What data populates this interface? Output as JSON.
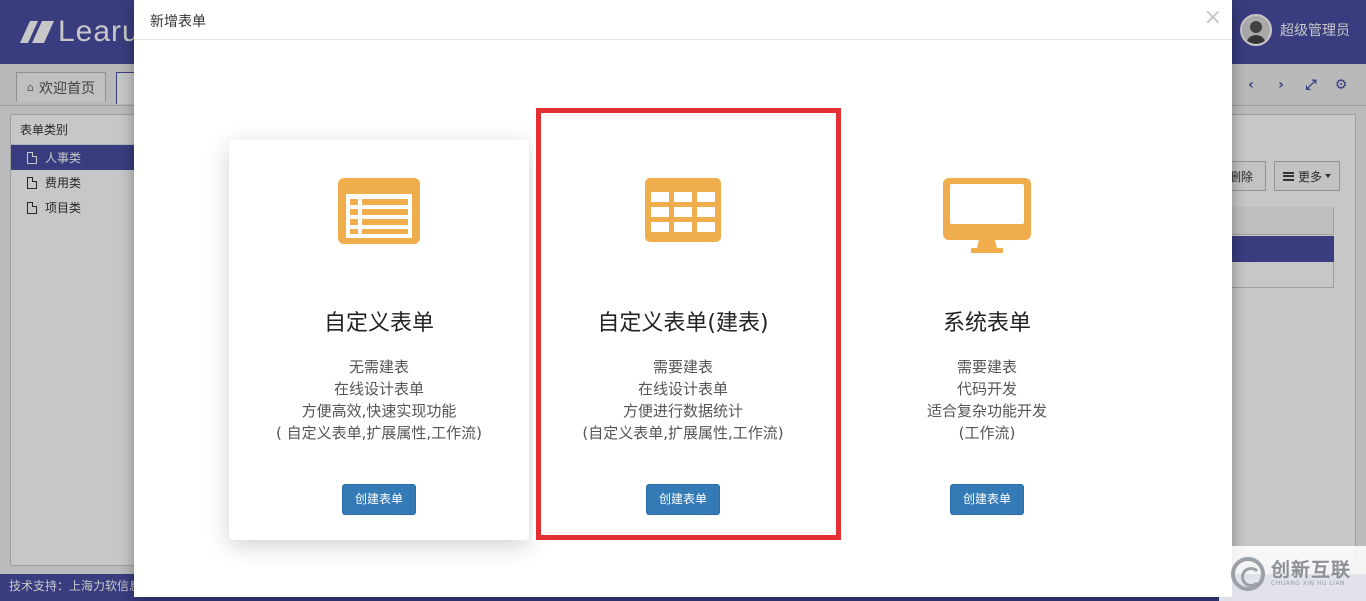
{
  "app": {
    "logo_text": "Learu",
    "user_name": "超级管理员",
    "tabs": [
      {
        "label": "欢迎首页"
      }
    ],
    "sidebar": {
      "title": "表单类别",
      "items": [
        {
          "label": "人事类",
          "active": true
        },
        {
          "label": "费用类",
          "active": false
        },
        {
          "label": "项目类",
          "active": false
        }
      ]
    },
    "toolbar": {
      "delete_label": "删除",
      "more_label": "更多"
    },
    "footer_text": "技术支持：上海力软信息"
  },
  "modal": {
    "title": "新增表单",
    "close_symbol": "×",
    "cards": [
      {
        "icon": "list-form-icon",
        "title": "自定义表单",
        "lines": [
          "无需建表",
          "在线设计表单",
          "方便高效,快速实现功能",
          "( 自定义表单,扩展属性,工作流)"
        ],
        "button_label": "创建表单"
      },
      {
        "icon": "table-grid-icon",
        "title": "自定义表单(建表)",
        "lines": [
          "需要建表",
          "在线设计表单",
          "方便进行数据统计",
          "(自定义表单,扩展属性,工作流)"
        ],
        "button_label": "创建表单"
      },
      {
        "icon": "monitor-icon",
        "title": "系统表单",
        "lines": [
          "需要建表",
          "代码开发",
          "适合复杂功能开发",
          "(工作流)"
        ],
        "button_label": "创建表单"
      }
    ],
    "highlighted_card": 1
  },
  "watermark": {
    "text": "创新互联",
    "sub": "CHUANG XIN HU LIAN"
  },
  "colors": {
    "brand": "#4a4ea3",
    "icon_orange": "#f0ad4e",
    "button_blue": "#337ab7",
    "highlight_red": "#e53033"
  }
}
